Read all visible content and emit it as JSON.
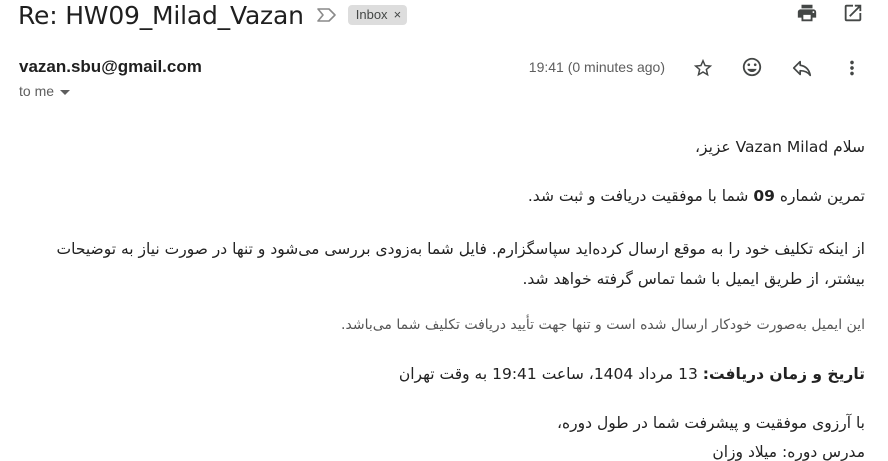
{
  "header": {
    "subject": "Re: HW09_Milad_Vazan",
    "label_chip": "Inbox",
    "chip_close": "×"
  },
  "message": {
    "sender": "vazan.sbu@gmail.com",
    "recipient": "to me",
    "timestamp": "19:41 (0 minutes ago)"
  },
  "body": {
    "greeting": "سلام Vazan Milad عزیز،",
    "exercise_pre": "تمرین شماره ",
    "exercise_num": "09",
    "exercise_post": " شما با موفقیت دریافت و ثبت شد.",
    "upload_text": "از اینکه تکلیف خود را به موقع ارسال کرده‌اید سپاسگزارم. فایل شما به‌زودی بررسی می‌شود و تنها در صورت نیاز به توضیحات بیشتر، از طریق ایمیل با شما تماس گرفته خواهد شد.",
    "auto_note": "این ایمیل به‌صورت خودکار ارسال شده است و تنها جهت تأیید دریافت تکلیف شما می‌باشد.",
    "date_label": "تاریخ و زمان دریافت:",
    "date_value": " 13 مرداد 1404، ساعت 19:41 به وقت تهران",
    "wish": "با آرزوی موفقیت و پیشرفت شما در طول دوره،",
    "signature": "مدرس دوره: میلاد وزان"
  },
  "icons": {
    "importance": "importance-marker-icon",
    "print": "print-icon",
    "open_new": "open-in-new-window-icon",
    "star": "star-icon",
    "emoji": "emoji-reaction-icon",
    "reply": "reply-icon",
    "more": "more-vert-icon"
  }
}
